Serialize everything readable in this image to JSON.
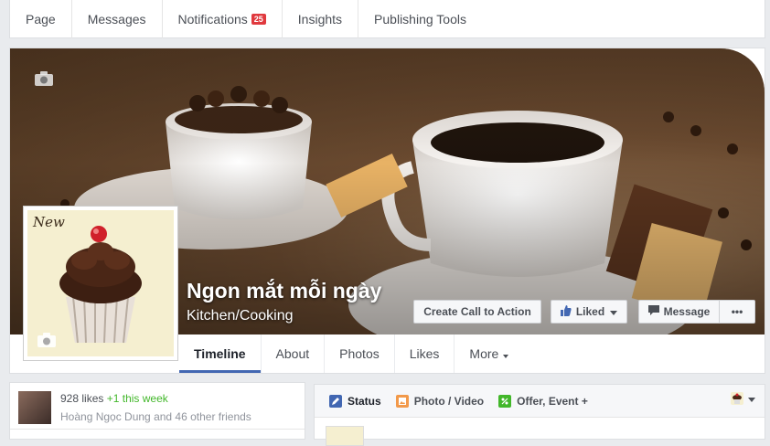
{
  "topnav": {
    "items": [
      "Page",
      "Messages",
      "Notifications",
      "Insights",
      "Publishing Tools"
    ],
    "notifications_badge": "25"
  },
  "page": {
    "name": "Ngon mắt mỗi ngày",
    "category": "Kitchen/Cooking",
    "profile_sticker": "New"
  },
  "actions": {
    "cta": "Create Call to Action",
    "liked": "Liked",
    "message": "Message",
    "more": "•••"
  },
  "tabs": [
    "Timeline",
    "About",
    "Photos",
    "Likes",
    "More"
  ],
  "likes_card": {
    "count": "928 likes",
    "delta": "+1 this week",
    "friends": "Hoàng Ngọc Dung and 46 other friends"
  },
  "composer": {
    "tabs": [
      "Status",
      "Photo / Video",
      "Offer, Event +"
    ]
  },
  "colors": {
    "accent": "#4267b2",
    "badge": "#e0393e",
    "positive": "#42b72a"
  }
}
